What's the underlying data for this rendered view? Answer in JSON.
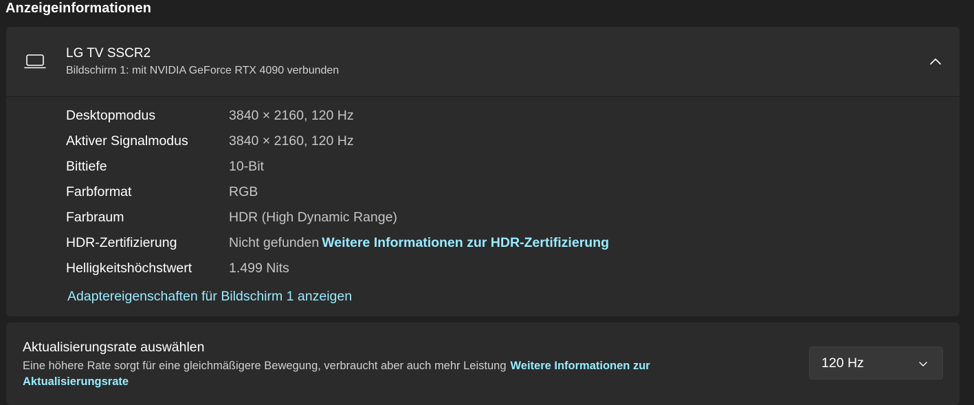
{
  "section": {
    "title": "Anzeigeinformationen"
  },
  "display": {
    "icon": "laptop-monitor-icon",
    "name": "LG TV SSCR2",
    "subtitle": "Bildschirm 1: mit NVIDIA GeForce RTX 4090 verbunden",
    "expanded": true
  },
  "info": {
    "rows": [
      {
        "label": "Desktopmodus",
        "value": "3840 × 2160, 120 Hz"
      },
      {
        "label": "Aktiver Signalmodus",
        "value": "3840 × 2160, 120 Hz"
      },
      {
        "label": "Bittiefe",
        "value": "10-Bit"
      },
      {
        "label": "Farbformat",
        "value": "RGB"
      },
      {
        "label": "Farbraum",
        "value": "HDR (High Dynamic Range)"
      },
      {
        "label": "HDR-Zertifizierung",
        "value": "Nicht gefunden",
        "link": "Weitere Informationen zur HDR-Zertifizierung"
      },
      {
        "label": "Helligkeitshöchstwert",
        "value": "1.499 Nits"
      }
    ],
    "adapter_link": "Adaptereigenschaften für Bildschirm 1 anzeigen"
  },
  "refresh_rate": {
    "title": "Aktualisierungsrate auswählen",
    "description": "Eine höhere Rate sorgt für eine gleichmäßigere Bewegung, verbraucht aber auch mehr Leistung",
    "link": "Weitere Informationen zur Aktualisierungsrate",
    "selected": "120 Hz"
  },
  "colors": {
    "background": "#202020",
    "card": "#2b2b2b",
    "link": "#99ebff",
    "secondary_text": "#c5c5c5"
  }
}
